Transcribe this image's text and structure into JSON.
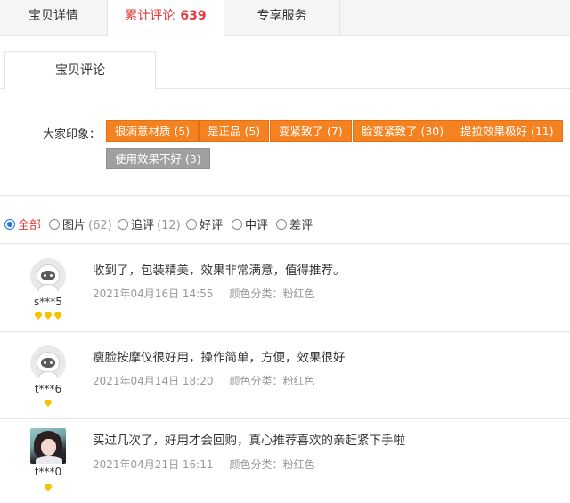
{
  "top_tabs": {
    "detail": "宝贝详情",
    "reviews_label": "累计评论",
    "reviews_count": "639",
    "service": "专享服务"
  },
  "sub_tab": {
    "label": "宝贝评论"
  },
  "impressions": {
    "label": "大家印象：",
    "tags": [
      {
        "text": "很满意材质 (5)"
      },
      {
        "text": "是正品 (5)"
      },
      {
        "text": "变紧致了 (7)"
      },
      {
        "text": "脸变紧致了 (30)"
      },
      {
        "text": "提拉效果极好 (11)"
      },
      {
        "text": "使用效果不好 (3)"
      }
    ]
  },
  "filters": {
    "all": {
      "label": "全部"
    },
    "pictures": {
      "label": "图片",
      "count": "(62)"
    },
    "followup": {
      "label": "追评",
      "count": "(12)"
    },
    "good": {
      "label": "好评"
    },
    "medium": {
      "label": "中评"
    },
    "bad": {
      "label": "差评"
    },
    "selected": "all"
  },
  "reviews": [
    {
      "username": "s***5",
      "badge_count": 3,
      "text": "收到了，包装精美，效果非常满意，值得推荐。",
      "date": "2021年04月16日 14:55",
      "variant": "颜色分类：粉红色",
      "avatar": "default"
    },
    {
      "username": "t***6",
      "badge_count": 1,
      "text": "瘦脸按摩仪很好用，操作简单，方便，效果很好",
      "date": "2021年04月14日 18:20",
      "variant": "颜色分类：粉红色",
      "avatar": "default"
    },
    {
      "username": "t***0",
      "badge_count": 1,
      "text": "买过几次了，好用才会回购，真心推荐喜欢的亲赶紧下手啦",
      "date": "2021年04月21日 16:11",
      "variant": "颜色分类：粉红色",
      "avatar": "photo"
    }
  ],
  "colors": {
    "accent_orange": "#f58220",
    "tag_gray": "#a0a0a0",
    "active_red": "#e4393c",
    "badge_gold": "#f7c300"
  }
}
